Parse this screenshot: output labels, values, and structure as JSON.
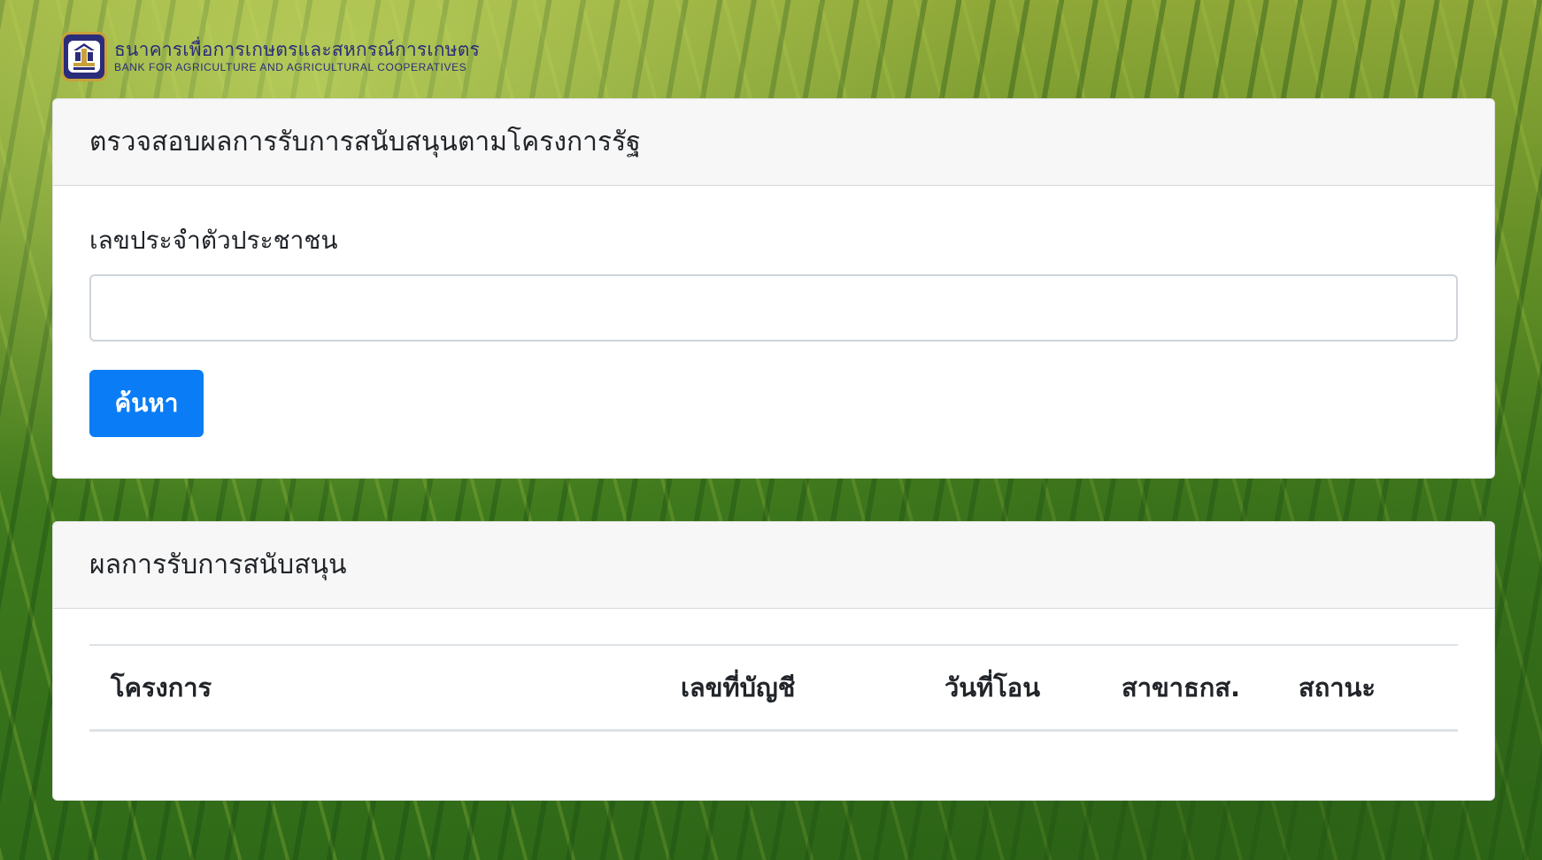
{
  "logo": {
    "thai_name": "ธนาคารเพื่อการเกษตรและสหกรณ์การเกษตร",
    "english_name": "BANK FOR AGRICULTURE AND AGRICULTURAL COOPERATIVES",
    "colors": {
      "primary": "#2b2c7a",
      "accent": "#c9a13a"
    }
  },
  "search_card": {
    "title": "ตรวจสอบผลการรับการสนับสนุนตามโครงการรัฐ",
    "id_label": "เลขประจำตัวประชาชน",
    "id_value": "",
    "search_button": "ค้นหา",
    "button_color": "#0a7cf5"
  },
  "results_card": {
    "title": "ผลการรับการสนับสนุน",
    "columns": [
      "โครงการ",
      "เลขที่บัญชี",
      "วันที่โอน",
      "สาขาธกส.",
      "สถานะ"
    ],
    "rows": []
  }
}
